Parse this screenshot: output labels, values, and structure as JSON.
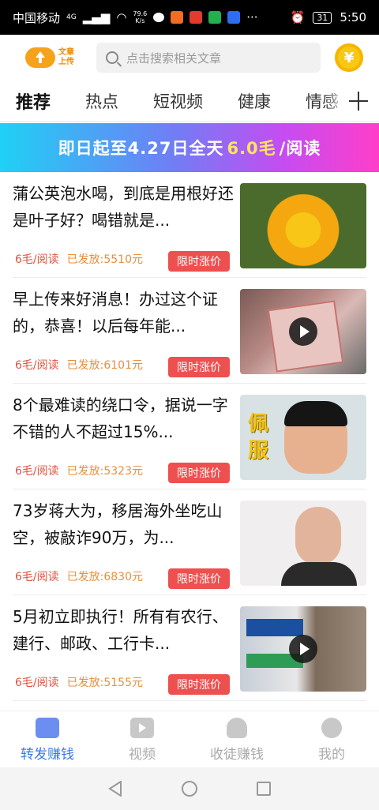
{
  "status_bar": {
    "carrier": "中国移动",
    "signal": "4G",
    "net_speed_value": "79.6",
    "net_speed_unit": "K/s",
    "battery": "31",
    "time": "5:50"
  },
  "header": {
    "logo_text": "文章上传",
    "search_placeholder": "点击搜索相关文章",
    "coin_symbol": "¥"
  },
  "tabs": [
    "推荐",
    "热点",
    "短视频",
    "健康",
    "情感"
  ],
  "banner": {
    "prefix": "即日起至4.27日全天",
    "highlight": "6.0毛",
    "suffix": "/阅读"
  },
  "articles": [
    {
      "title": "蒲公英泡水喝，到底是用根好还是叶子好？喝错就是...",
      "price": "6毛/阅读",
      "issued": "已发放:5510元",
      "badge": "限时涨价",
      "has_video": false
    },
    {
      "title": "早上传来好消息！办过这个证的，恭喜！以后每年能...",
      "price": "6毛/阅读",
      "issued": "已发放:6101元",
      "badge": "限时涨价",
      "has_video": true
    },
    {
      "title": "8个最难读的绕口令，据说一字不错的人不超过15%...",
      "price": "6毛/阅读",
      "issued": "已发放:5323元",
      "badge": "限时涨价",
      "has_video": false,
      "thumb_text": "佩服"
    },
    {
      "title": "73岁蒋大为，移居海外坐吃山空，被敲诈90万，为...",
      "price": "6毛/阅读",
      "issued": "已发放:6830元",
      "badge": "限时涨价",
      "has_video": false
    },
    {
      "title": "5月初立即执行！所有有农行、建行、邮政、工行卡...",
      "price": "6毛/阅读",
      "issued": "已发放:5155元",
      "badge": "限时涨价",
      "has_video": true
    }
  ],
  "bottom_nav": [
    {
      "label": "转发赚钱",
      "icon": "article-icon",
      "active": true
    },
    {
      "label": "视频",
      "icon": "video-icon",
      "active": false
    },
    {
      "label": "收徒赚钱",
      "icon": "add-user-icon",
      "active": false
    },
    {
      "label": "我的",
      "icon": "profile-icon",
      "active": false
    }
  ]
}
